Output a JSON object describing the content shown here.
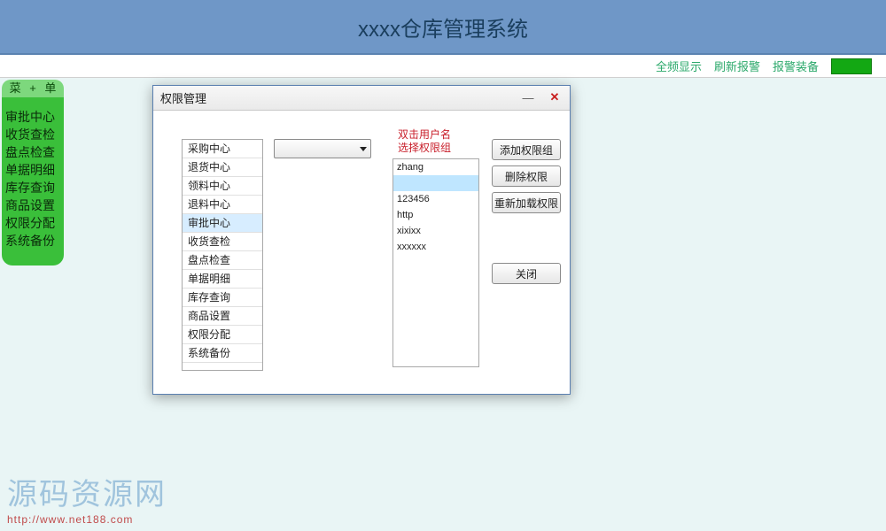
{
  "header": {
    "title": "xxxx仓库管理系统"
  },
  "topbar": {
    "full_screen": "全频显示",
    "refresh_alarm": "刷新报警",
    "alarm_device": "报警装备"
  },
  "sidebar": {
    "header": "菜 + 单",
    "items": [
      "审批中心",
      "收货查检",
      "盘点检查",
      "单据明细",
      "库存查询",
      "商品设置",
      "权限分配",
      "系统备份"
    ]
  },
  "dialog": {
    "title": "权限管理",
    "modules": {
      "items": [
        "采购中心",
        "退货中心",
        "领料中心",
        "退料中心",
        "审批中心",
        "收货查检",
        "盘点检查",
        "单据明细",
        "库存查询",
        "商品设置",
        "权限分配",
        "系统备份"
      ],
      "selected_index": 4
    },
    "dropdown": {
      "value": ""
    },
    "hint_line1": "双击用户名",
    "hint_line2": "选择权限组",
    "users": {
      "items": [
        "zhang",
        "",
        "123456",
        "http",
        "xixixx",
        "xxxxxx"
      ],
      "selected_index": 1
    },
    "buttons": {
      "add_group": "添加权限组",
      "delete_perm": "删除权限",
      "reload_perm": "重新加载权限",
      "close": "关闭"
    }
  },
  "watermark": {
    "big": "源码资源网",
    "small": "http://www.net188.com"
  }
}
